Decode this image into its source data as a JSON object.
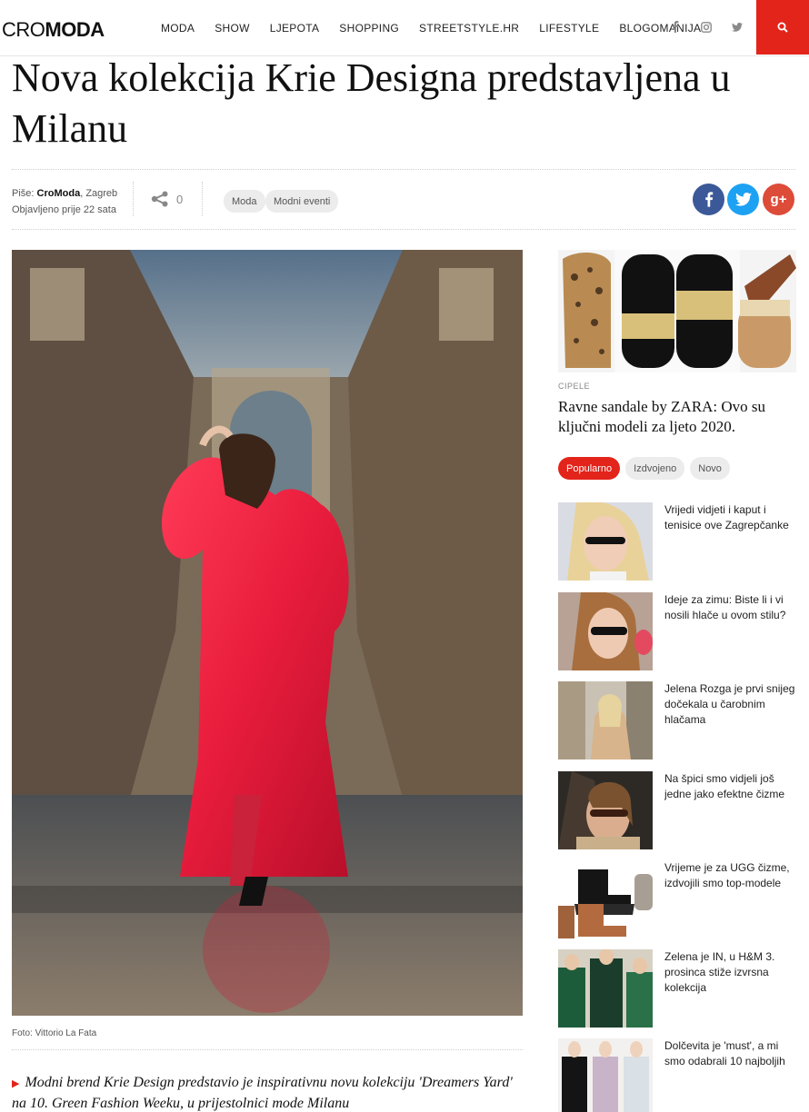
{
  "header": {
    "logo_part1": "CRO",
    "logo_part2": "MODA",
    "nav": [
      "MODA",
      "SHOW",
      "LJEPOTA",
      "SHOPPING",
      "STREETSTYLE.HR",
      "LIFESTYLE",
      "BLOGOMANIJA"
    ],
    "social_icons": [
      "facebook-icon",
      "instagram-icon",
      "twitter-icon"
    ],
    "search_icon": "search-icon",
    "accent": "#e3241b"
  },
  "article": {
    "title": "Nova kolekcija Krie Designa predstavljena u Milanu",
    "author_label": "Piše:",
    "author": "CroModa",
    "location": ", Zagreb",
    "published": "Objavljeno prije 22 sata",
    "share_count": "0",
    "tags": [
      "Moda",
      "Modni eventi"
    ],
    "share_buttons": [
      {
        "icon": "facebook-icon",
        "color": "#3b5998",
        "glyph": "f"
      },
      {
        "icon": "twitter-icon",
        "color": "#1da1f2",
        "glyph": "t"
      },
      {
        "icon": "googleplus-icon",
        "color": "#dd4b39",
        "glyph": "g+"
      }
    ],
    "photo_caption": "Foto: Vittorio La Fata",
    "lede": "Modni brend Krie Design predstavio je inspirativnu novu kolekciju 'Dreamers Yard' na 10. Green Fashion Weeku, u prijestolnici mode Milanu"
  },
  "sidebar": {
    "featured": {
      "category": "CIPELE",
      "title": "Ravne sandale by ZARA: Ovo su ključni modeli za ljeto 2020."
    },
    "tabs": [
      "Popularno",
      "Izdvojeno",
      "Novo"
    ],
    "items": [
      {
        "title": "Vrijedi vidjeti i kaput i tenisice ove Zagrepčanke"
      },
      {
        "title": "Ideje za zimu: Biste li i vi nosili hlače u ovom stilu?"
      },
      {
        "title": "Jelena Rozga je prvi snijeg dočekala u čarobnim hlačama"
      },
      {
        "title": "Na špici smo vidjeli još jedne jako efektne čizme"
      },
      {
        "title": "Vrijeme je za UGG čizme, izdvojili smo top-modele"
      },
      {
        "title": "Zelena je IN, u H&M 3. prosinca stiže izvrsna kolekcija"
      },
      {
        "title": "Dolčevita je 'must', a mi smo odabrali 10 najboljih"
      }
    ]
  }
}
